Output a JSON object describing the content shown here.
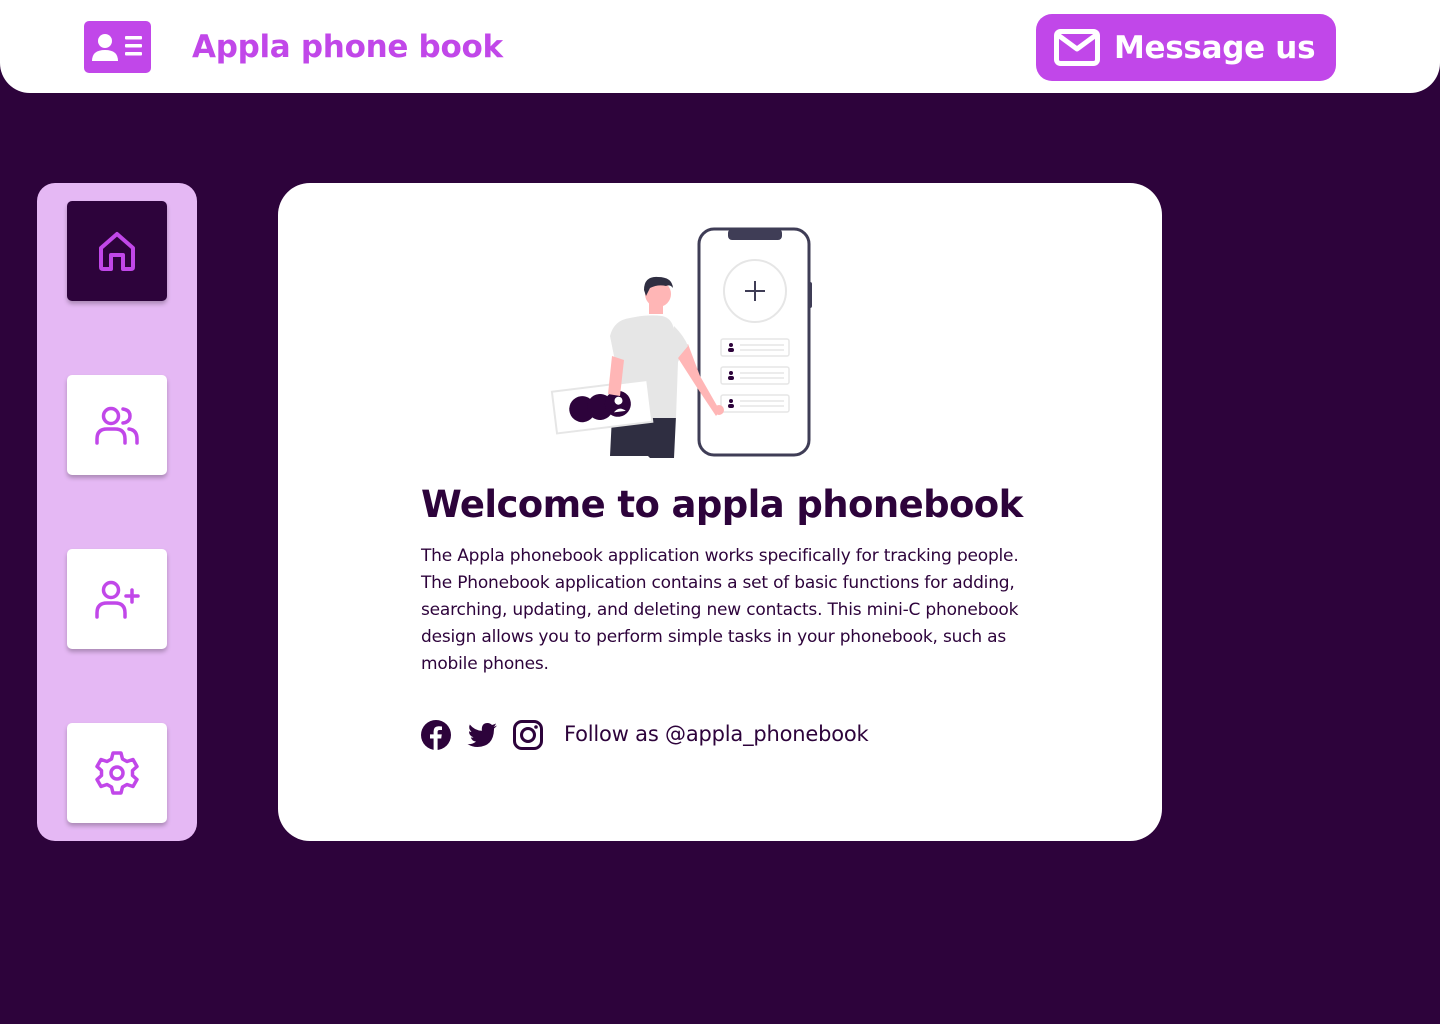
{
  "colors": {
    "background": "#2d033b",
    "accent": "#c147e9",
    "sidebar": "#e5b8f4",
    "text": "#2d033b",
    "surface": "#ffffff"
  },
  "header": {
    "logo_icon": "contact-card-icon",
    "title": "Appla phone book",
    "message_button": {
      "label": "Message us",
      "icon": "mail-icon"
    }
  },
  "sidebar": {
    "items": [
      {
        "icon": "home-icon",
        "active": true
      },
      {
        "icon": "users-icon",
        "active": false
      },
      {
        "icon": "user-plus-icon",
        "active": false
      },
      {
        "icon": "settings-gear-icon",
        "active": false
      }
    ]
  },
  "main": {
    "illustration": "person-with-phone-contacts-illustration",
    "heading": "Welcome to appla phonebook",
    "description": "The Appla  phonebook application works specifically for tracking people. The Phonebook application contains a set of basic functions for adding, searching, updating, and deleting new contacts. This mini-C phonebook design allows you to perform simple tasks in your phonebook, such as mobile phones.",
    "social": {
      "icons": [
        "facebook-icon",
        "twitter-icon",
        "instagram-icon"
      ],
      "follow_text": "Follow as @appla_phonebook"
    }
  }
}
